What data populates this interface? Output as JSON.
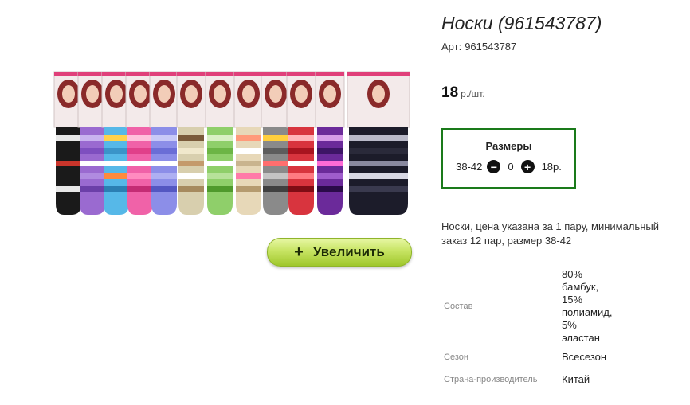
{
  "product": {
    "title": "Носки (961543787)",
    "art_label": "Арт:",
    "art_value": "961543787",
    "price_value": "18",
    "price_unit": "р./шт.",
    "enlarge_label": "Увеличить",
    "description": "Носки, цена указана за 1 пару, минимальный заказ 12 пар, размер 38-42"
  },
  "sizes": {
    "heading": "Размеры",
    "size": "38-42",
    "quantity": "0",
    "unit_price": "18р."
  },
  "properties": [
    {
      "key": "Состав",
      "value": "80% бамбук, 15% полиамид, 5% эластан"
    },
    {
      "key": "Сезон",
      "value": "Всесезон"
    },
    {
      "key": "Страна-производитель",
      "value": "Китай"
    }
  ],
  "colors": {
    "accent_green": "#1a7a1a",
    "button_green": "#b5d648"
  },
  "icons": {
    "minus": "minus-circle-icon",
    "plus": "plus-circle-icon"
  }
}
